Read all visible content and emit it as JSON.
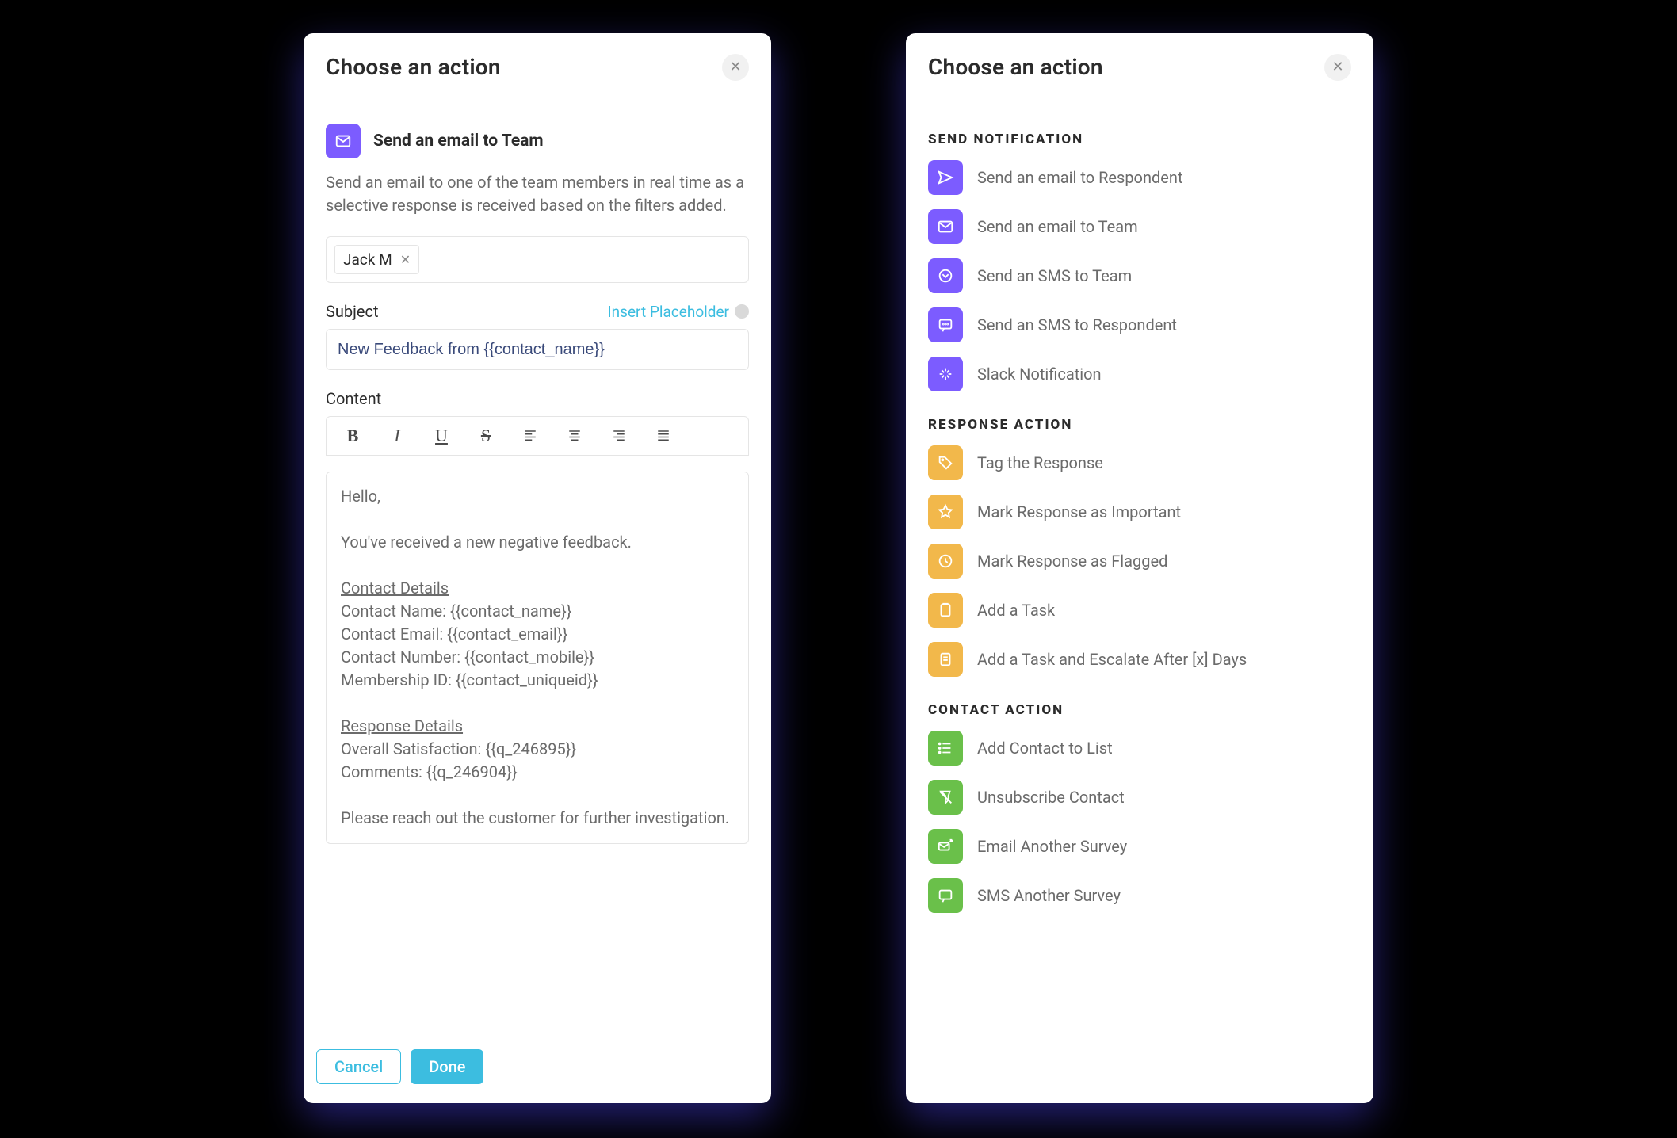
{
  "common": {
    "panel_title": "Choose an action"
  },
  "left": {
    "header_icon": "mail-icon",
    "header_title": "Send an email to Team",
    "description": "Send an email to one of the team members in real time as a selective response is received based on the filters added.",
    "recipients": [
      {
        "name": "Jack M"
      }
    ],
    "subject_label": "Subject",
    "insert_placeholder_label": "Insert Placeholder",
    "subject_value": "New Feedback from {{contact_name}}",
    "content_label": "Content",
    "toolbar": {
      "bold": "B",
      "italic": "I",
      "underline": "U",
      "strike": "S"
    },
    "content_lines": [
      "Hello,",
      "",
      "You've received a new negative feedback.",
      "",
      "__UNDERLINE__Contact Details",
      "Contact Name: {{contact_name}}",
      "Contact Email: {{contact_email}}",
      "Contact Number: {{contact_mobile}}",
      "Membership ID: {{contact_uniqueid}}",
      "",
      "__UNDERLINE__Response Details",
      "Overall Satisfaction: {{q_246895}}",
      "Comments: {{q_246904}}",
      "",
      "Please reach out the customer for further investigation."
    ],
    "footer": {
      "cancel": "Cancel",
      "done": "Done"
    }
  },
  "right": {
    "sections": [
      {
        "title": "SEND NOTIFICATION",
        "color": "violet",
        "items": [
          {
            "icon": "send-icon",
            "label": "Send an email to Respondent"
          },
          {
            "icon": "mail-icon",
            "label": "Send an email to Team"
          },
          {
            "icon": "sms-icon",
            "label": "Send an SMS to Team"
          },
          {
            "icon": "chat-icon",
            "label": "Send an SMS to Respondent"
          },
          {
            "icon": "slack-icon",
            "label": "Slack Notification"
          }
        ]
      },
      {
        "title": "RESPONSE ACTION",
        "color": "amber",
        "items": [
          {
            "icon": "tag-icon",
            "label": "Tag the Response"
          },
          {
            "icon": "star-icon",
            "label": "Mark Response as Important"
          },
          {
            "icon": "flag-icon",
            "label": "Mark Response as Flagged"
          },
          {
            "icon": "task-icon",
            "label": "Add a Task"
          },
          {
            "icon": "task-escalate-icon",
            "label": "Add a Task and Escalate After [x] Days"
          }
        ]
      },
      {
        "title": "CONTACT ACTION",
        "color": "green",
        "items": [
          {
            "icon": "list-icon",
            "label": "Add Contact to List"
          },
          {
            "icon": "unsubscribe-icon",
            "label": "Unsubscribe Contact"
          },
          {
            "icon": "mail-send-icon",
            "label": "Email Another Survey"
          },
          {
            "icon": "sms-send-icon",
            "label": "SMS Another Survey"
          }
        ]
      }
    ]
  }
}
